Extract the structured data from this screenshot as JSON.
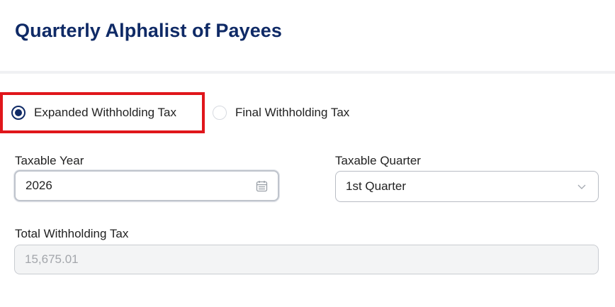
{
  "header": {
    "title": "Quarterly Alphalist of Payees"
  },
  "tax_type": {
    "options": [
      {
        "label": "Expanded Withholding Tax",
        "selected": true
      },
      {
        "label": "Final Withholding Tax",
        "selected": false
      }
    ]
  },
  "form": {
    "taxable_year": {
      "label": "Taxable Year",
      "value": "2026",
      "icon": "calendar-icon"
    },
    "taxable_quarter": {
      "label": "Taxable Quarter",
      "value": "1st Quarter",
      "icon": "chevron-down-icon"
    },
    "total_withholding_tax": {
      "label": "Total Withholding Tax",
      "value": "15,675.01"
    }
  },
  "colors": {
    "title": "#0f2a66",
    "highlight_border": "#e0161b",
    "radio_selected": "#0f2a66"
  }
}
